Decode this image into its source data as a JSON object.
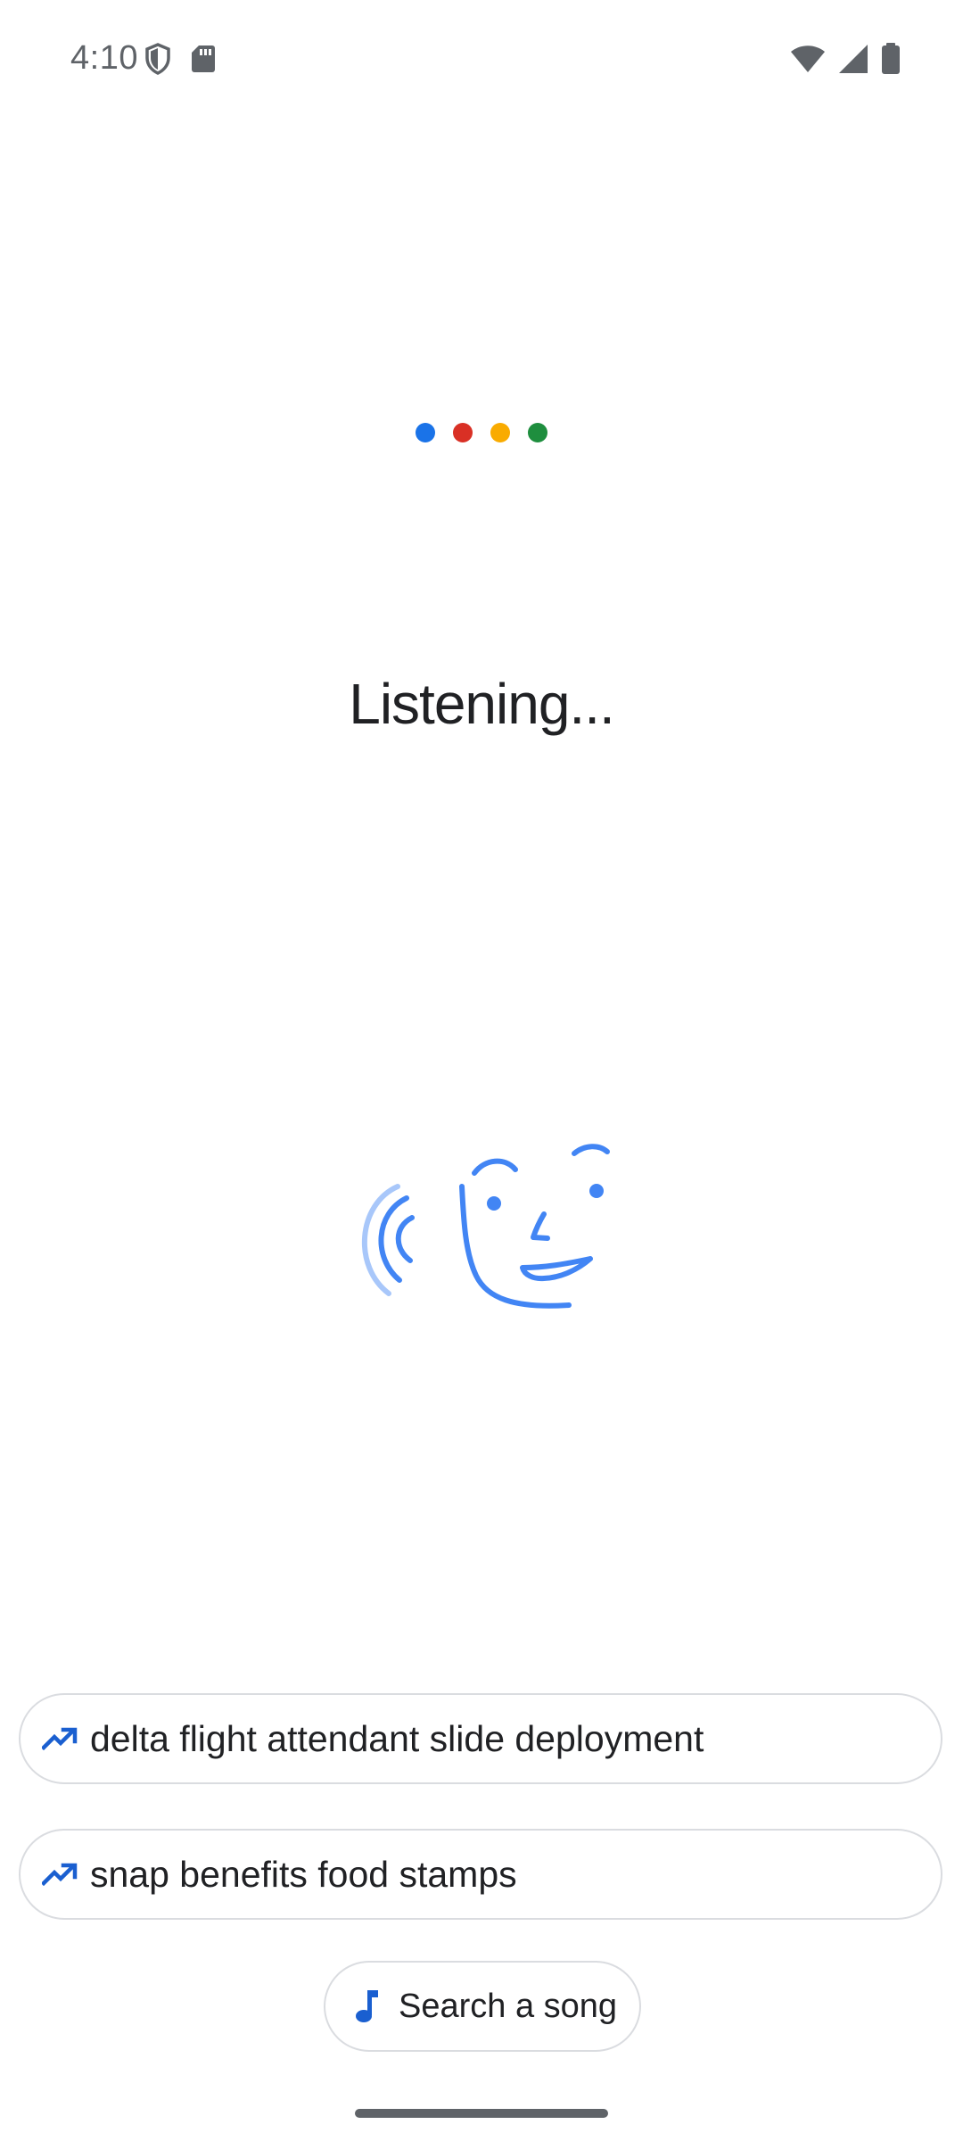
{
  "status_bar": {
    "time": "4:10",
    "left_icons": [
      "shield-icon",
      "sd-card-icon"
    ],
    "right_icons": [
      "wifi-icon",
      "cellular-signal-icon",
      "battery-icon"
    ]
  },
  "assistant": {
    "dot_colors": [
      "#1a73e8",
      "#d93025",
      "#f9ab00",
      "#1e8e3e"
    ],
    "status_text": "Listening..."
  },
  "illustration": {
    "icon": "listening-face-illustration",
    "color": "#4285f4",
    "light_color": "#a8c7fa"
  },
  "suggestions": [
    {
      "icon": "trending-icon",
      "label": "delta flight attendant slide deployment"
    },
    {
      "icon": "trending-icon",
      "label": "snap benefits food stamps"
    }
  ],
  "search_song": {
    "icon": "music-note-icon",
    "label": "Search a song"
  },
  "colors": {
    "accent": "#1a5fd0",
    "text": "#202124",
    "chip_border": "#dadce0"
  }
}
